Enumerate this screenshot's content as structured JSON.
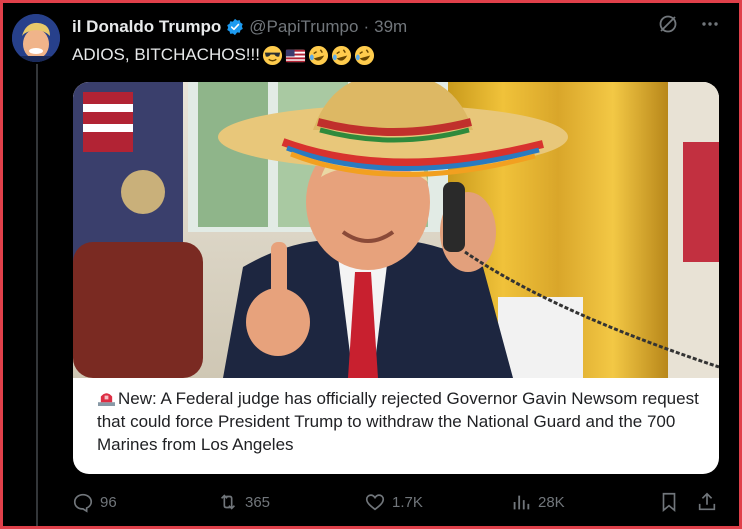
{
  "author": {
    "display_name": "il Donaldo Trumpo",
    "handle": "@PapiTrumpo",
    "separator": "·",
    "time_ago": "39m",
    "verified": true
  },
  "tweet": {
    "text": "ADIOS, BITCHACHOS!!!",
    "emojis": [
      "smiling-face-with-sunglasses",
      "us-flag",
      "rolling-on-floor-laughing",
      "rolling-on-floor-laughing",
      "rolling-on-floor-laughing"
    ]
  },
  "media": {
    "image_kind": "photo-illustration",
    "caption": "New: A Federal judge has officially rejected Governor Gavin Newsom request that could force President Trump to withdraw the National Guard and the 700 Marines from Los Angeles",
    "caption_prefix_icon": "police-siren-icon"
  },
  "actions": {
    "replies": "96",
    "reposts": "365",
    "likes": "1.7K",
    "views": "28K"
  },
  "colors": {
    "background": "#000000",
    "frame": "#e0404a",
    "text": "#e7e9ea",
    "muted": "#71767b",
    "verified": "#1d9bf0"
  }
}
